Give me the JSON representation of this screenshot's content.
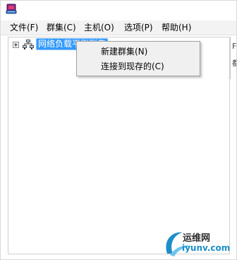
{
  "menubar": {
    "items": [
      {
        "label": "文件(F)"
      },
      {
        "label": "群集(C)"
      },
      {
        "label": "主机(O)"
      },
      {
        "label": "选项(P)"
      },
      {
        "label": "帮助(H)"
      }
    ]
  },
  "tree": {
    "root_node_label": "网络负载平衡群集"
  },
  "right_pane": {
    "header_text": "F",
    "row_text": "都"
  },
  "context_menu": {
    "items": [
      {
        "label": "新建群集(N)"
      },
      {
        "label": "连接到现存的(C)"
      }
    ]
  },
  "watermark": {
    "top_text": "运维网",
    "bottom_text": "iyunv.com"
  },
  "colors": {
    "selection": "#3399ff",
    "menu_bg": "#f0f0f0",
    "menubar_bg": "#f3f3f3",
    "watermark_blue": "#1d8fc8"
  },
  "icons": {
    "app": "nlb-manager-icon",
    "tree_node": "network-cluster-icon",
    "expander": "plus-expander-icon",
    "watermark": "swoosh-logo-icon"
  }
}
